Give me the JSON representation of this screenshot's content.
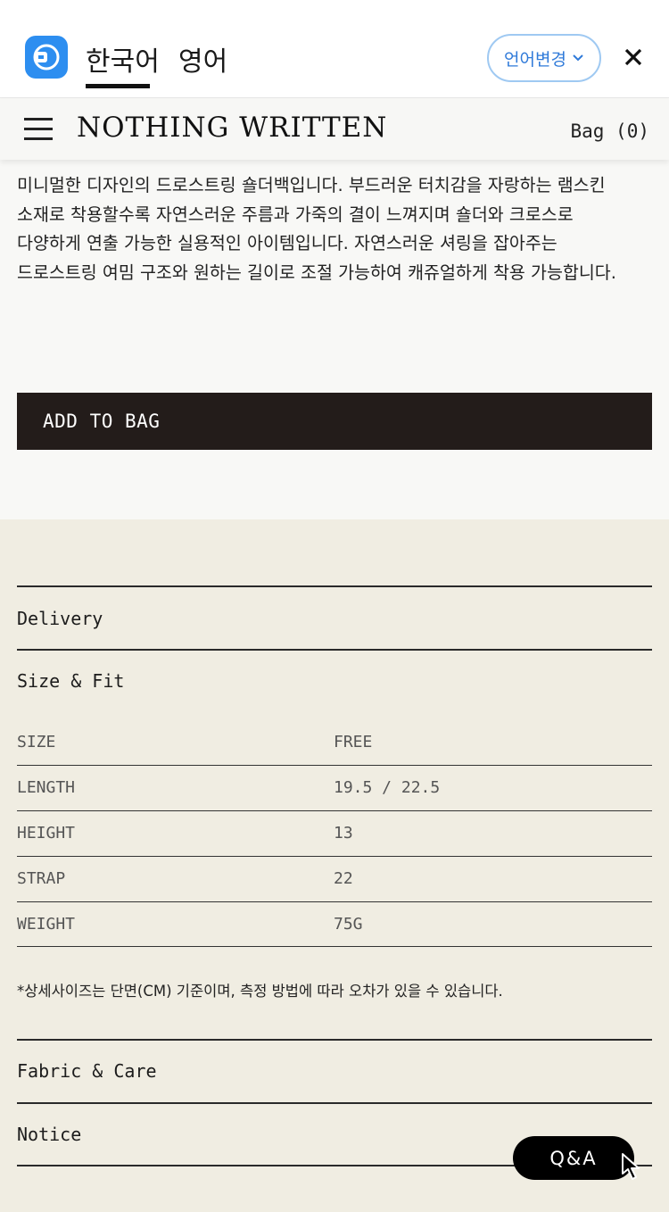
{
  "translate_bar": {
    "tab_korean": "한국어",
    "tab_english": "영어",
    "change_language": "언어변경",
    "accent_color": "#2d8ef0"
  },
  "header": {
    "brand": "NOTHING WRITTEN",
    "bag": "Bag (0)"
  },
  "product": {
    "description_lines": [
      "미니멀한 디자인의 드로스트링 숄더백입니다. 부드러운 터치감을 자랑하는 램스킨",
      "소재로 착용할수록 자연스러운 주름과 가죽의 결이 느껴지며 숄더와 크로스로",
      "다양하게 연출 가능한 실용적인 아이템입니다. 자연스러운 셔링을 잡아주는",
      "드로스트링 여밈 구조와 원하는 길이로 조절 가능하여 캐쥬얼하게 착용 가능합니다."
    ],
    "add_to_bag": "ADD TO BAG"
  },
  "sections": {
    "delivery": "Delivery",
    "size_fit": "Size & Fit",
    "fabric_care": "Fabric & Care",
    "notice": "Notice"
  },
  "size_table": [
    {
      "label": "SIZE",
      "value": "FREE"
    },
    {
      "label": "LENGTH",
      "value": "19.5 / 22.5"
    },
    {
      "label": "HEIGHT",
      "value": "13"
    },
    {
      "label": "STRAP",
      "value": "22"
    },
    {
      "label": "WEIGHT",
      "value": "75G"
    }
  ],
  "size_note": "*상세사이즈는 단면(CM) 기준이며, 측정 방법에 따라 오차가 있을 수 있습니다.",
  "qa_button": "Q&A",
  "icons": {
    "app_logo": "translate-app-icon",
    "language_chevron": "chevron-down-icon",
    "close": "close-icon",
    "menu": "hamburger-icon",
    "cursor": "pointer-cursor-icon"
  }
}
